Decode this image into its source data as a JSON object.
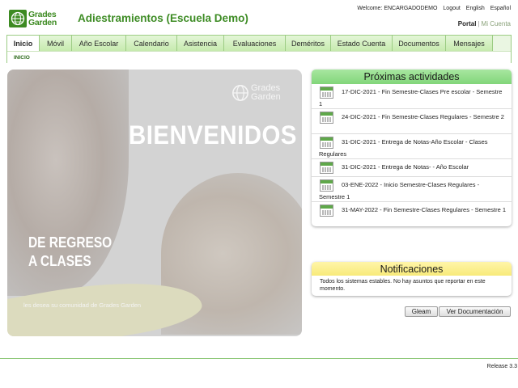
{
  "header": {
    "logo_line1": "Grades",
    "logo_line2": "Garden",
    "app_title": "Adiestramientos (Escuela Demo)",
    "welcome": "Welcome: ENCARGADODEMO",
    "logout": "Logout",
    "lang_english": "English",
    "lang_espanol": "Español",
    "portal": "Portal",
    "mi_cuenta": "Mi Cuenta"
  },
  "nav": {
    "tabs": [
      {
        "label": "Inicio",
        "active": true
      },
      {
        "label": "Móvil",
        "active": false
      },
      {
        "label": "Año Escolar",
        "active": false
      },
      {
        "label": "Calendario",
        "active": false
      },
      {
        "label": "Asistencia",
        "active": false
      },
      {
        "label": "Evaluaciones",
        "active": false
      },
      {
        "label": "Deméritos",
        "active": false
      },
      {
        "label": "Estado Cuenta",
        "active": false
      },
      {
        "label": "Documentos",
        "active": false
      },
      {
        "label": "Mensajes",
        "active": false
      }
    ],
    "breadcrumb": "INICIO"
  },
  "banner": {
    "heading": "BIENVENIDOS",
    "subheading_line1": "DE REGRESO",
    "subheading_line2": "A CLASES",
    "tagline": "les desea su comunidad de Grades Garden",
    "watermark_line1": "Grades",
    "watermark_line2": "Garden"
  },
  "actividades": {
    "title": "Próximas actividades",
    "items": [
      "17-DIC-2021 - Fin Semestre-Clases Pre escolar - Semestre 1",
      "24-DIC-2021 - Fin Semestre-Clases Regulares - Semestre 2",
      "31-DIC-2021 - Entrega de Notas-Año Escolar - Clases Regulares",
      "31-DIC-2021 - Entrega de Notas- - Año Escolar",
      "03-ENE-2022 - Inicio Semestre-Clases Regulares - Semestre 1",
      "31-MAY-2022 - Fin Semestre-Clases Regulares - Semestre 1"
    ]
  },
  "notificaciones": {
    "title": "Notificaciones",
    "text": "Todos los sistemas estables. No hay asuntos que reportar en este momento."
  },
  "buttons": {
    "gleam": "Gleam",
    "ver_documentacion": "Ver Documentación"
  },
  "footer": {
    "release": "Release 3.3"
  },
  "colors": {
    "brand_green": "#3e8c25",
    "nav_border": "#9ccc84",
    "activities_header": "#8fdb86",
    "notifications_header": "#fbef8e"
  }
}
